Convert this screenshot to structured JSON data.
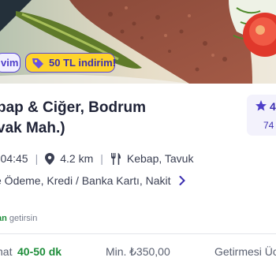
{
  "badges": {
    "left_chip": "vim",
    "discount": "50 TL indirim!"
  },
  "restaurant": {
    "name_line1": "bap & Ciğer, Bodrum",
    "name_line2": "vak Mah.)",
    "rating": "4",
    "review_count": "74"
  },
  "info": {
    "hours": "- 04:45",
    "distance": "4.2 km",
    "cuisine": "Kebap, Tavuk",
    "payment": "e Ödeme, Kredi / Banka Kartı, Nakit"
  },
  "courier": {
    "highlight": "an",
    "rest": " getirsin"
  },
  "delivery": {
    "time_label": "nat",
    "time_value": "40-50 dk",
    "min_label": "Min.",
    "min_value": "₺350,00",
    "fee_label": "Getirmesi Üc"
  },
  "colors": {
    "accent": "#5b48d6",
    "discount_bg": "#ffd42a",
    "green": "#1e8d3a",
    "text": "#1f2337"
  }
}
